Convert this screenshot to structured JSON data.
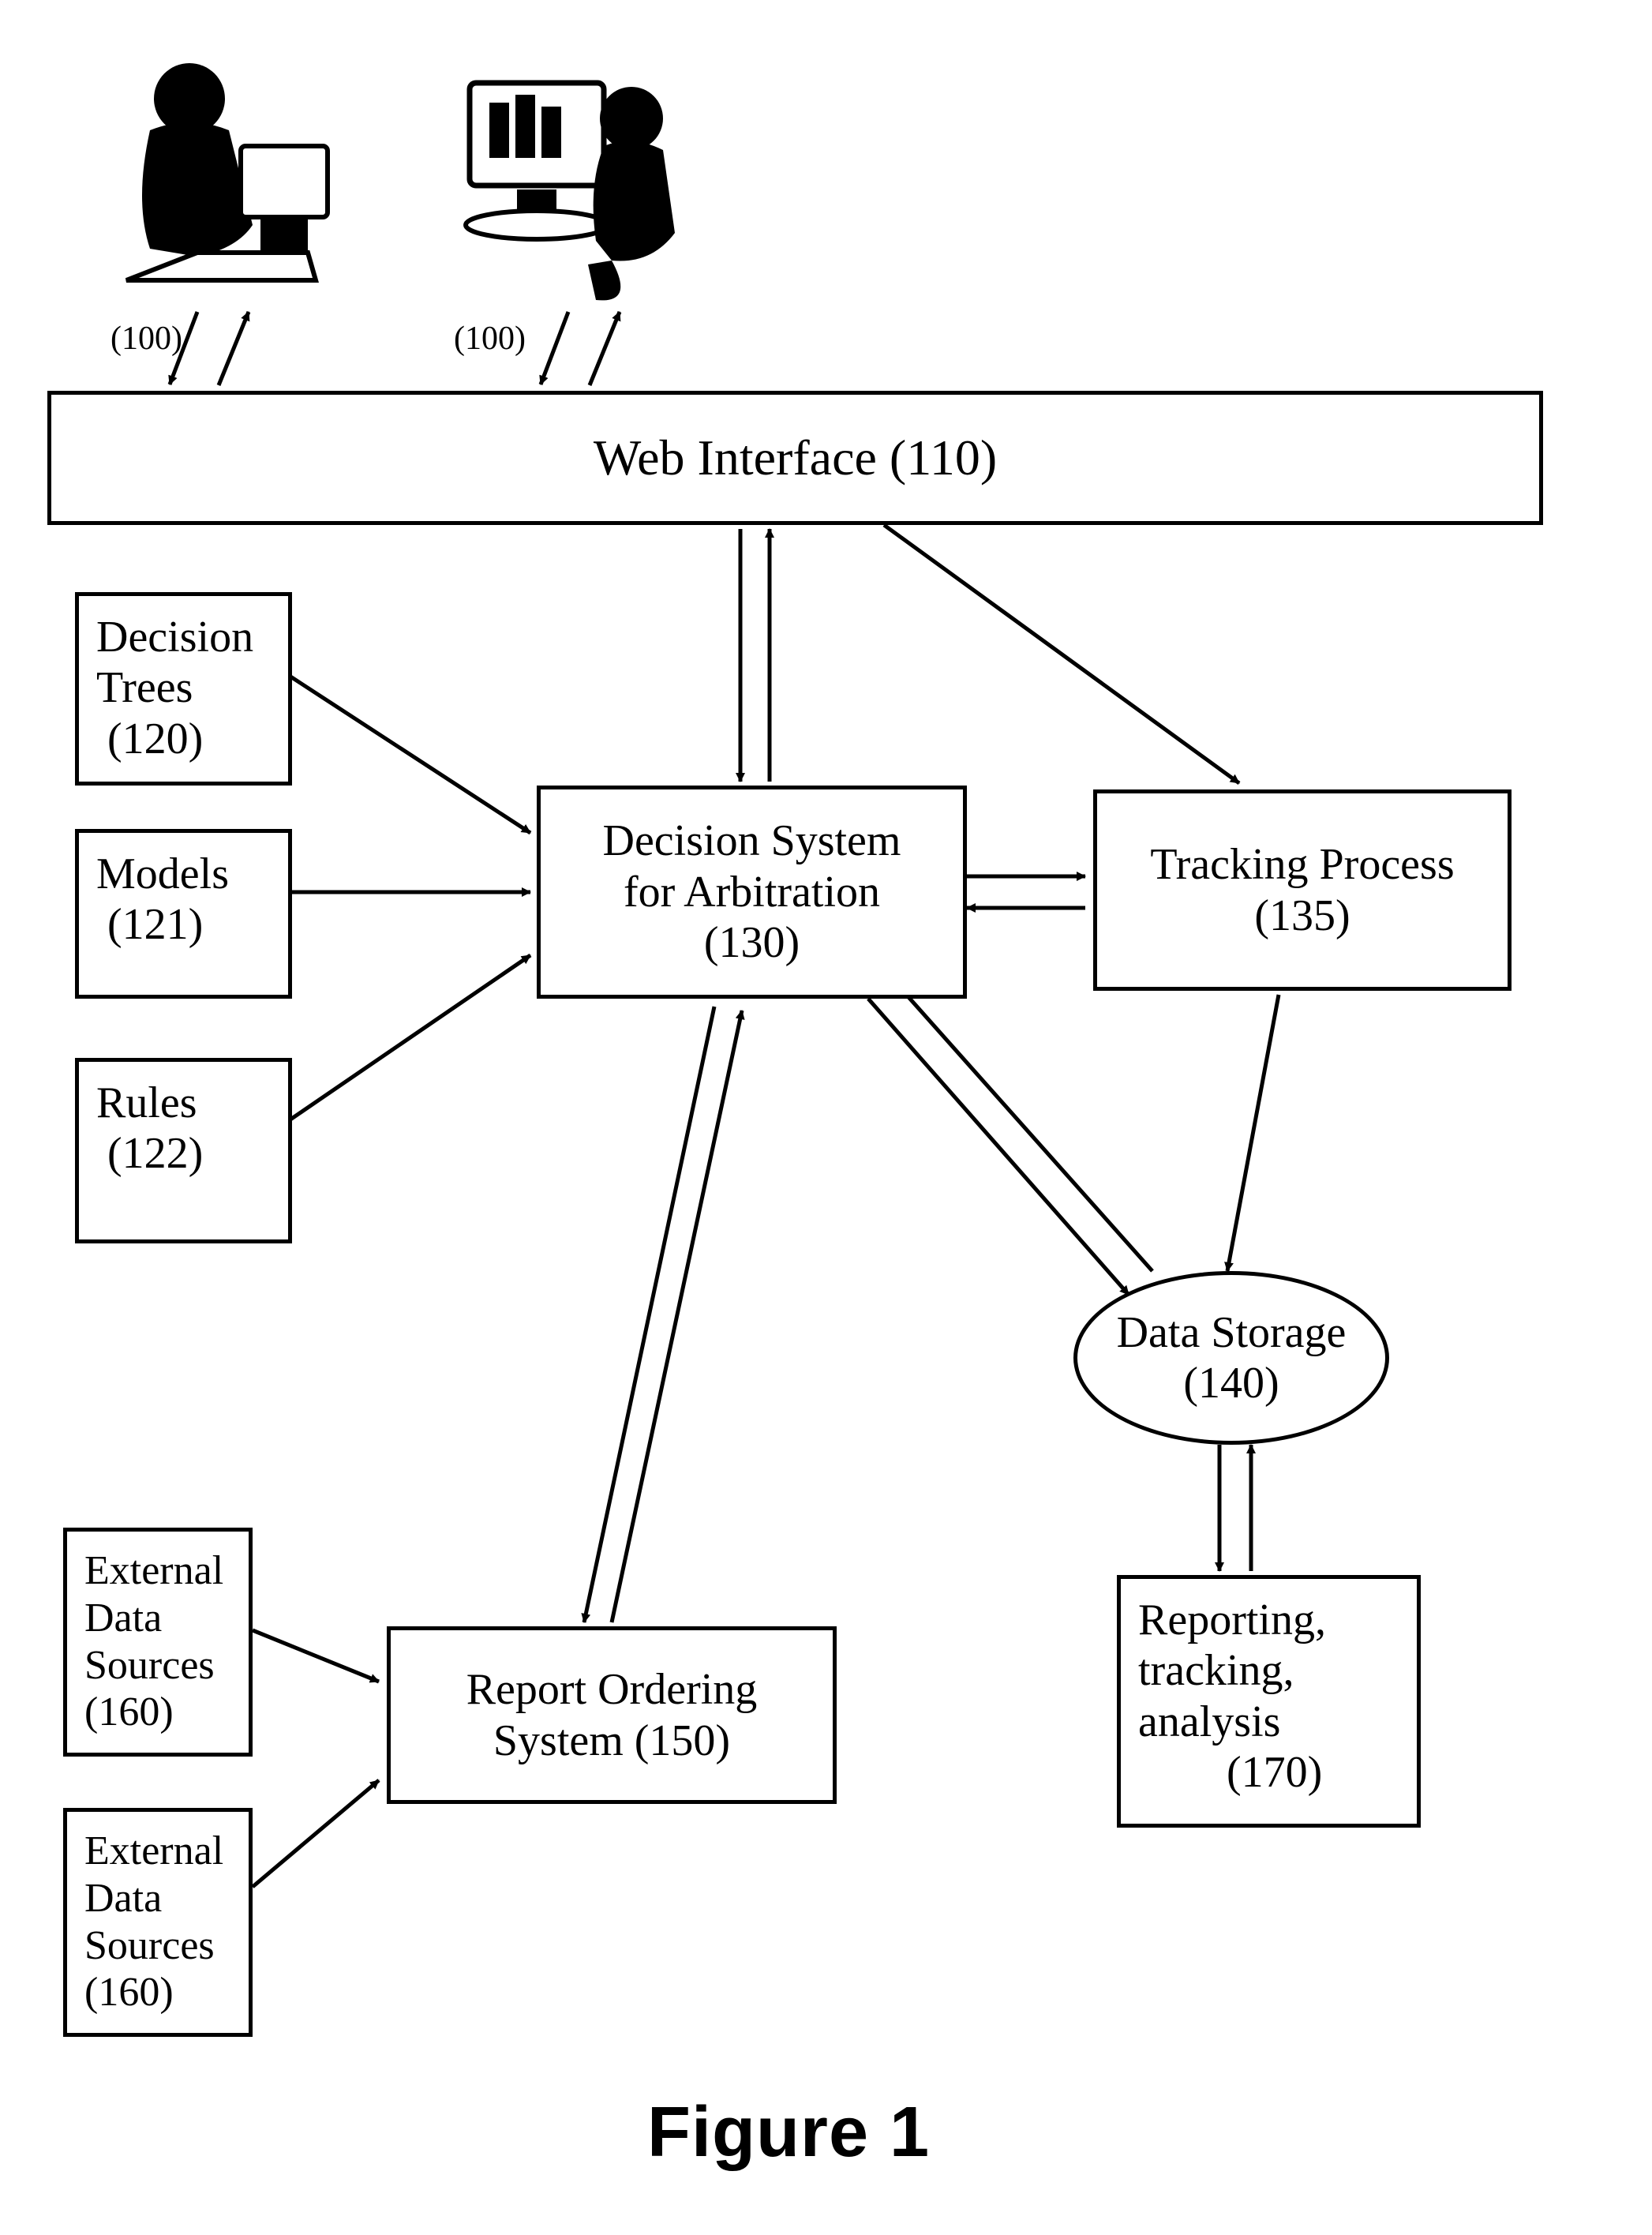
{
  "figure_title": "Figure 1",
  "users": {
    "label_left": "(100)",
    "label_right": "(100)"
  },
  "web_interface": {
    "title": "Web Interface (110)"
  },
  "inputs": {
    "decision_trees": "Decision\nTrees\n (120)",
    "models": "Models\n (121)",
    "rules": "Rules\n (122)"
  },
  "decision_system": {
    "title": "Decision System\nfor Arbitration\n(130)"
  },
  "tracking_process": {
    "title": "Tracking Process\n(135)"
  },
  "data_storage": {
    "title": "Data Storage\n(140)"
  },
  "report_ordering": {
    "title": "Report Ordering\nSystem (150)"
  },
  "external_sources": {
    "a": "External\nData\nSources\n(160)",
    "b": "External\nData\nSources\n(160)"
  },
  "reporting": {
    "title": "Reporting,\ntracking,\nanalysis\n        (170)"
  }
}
